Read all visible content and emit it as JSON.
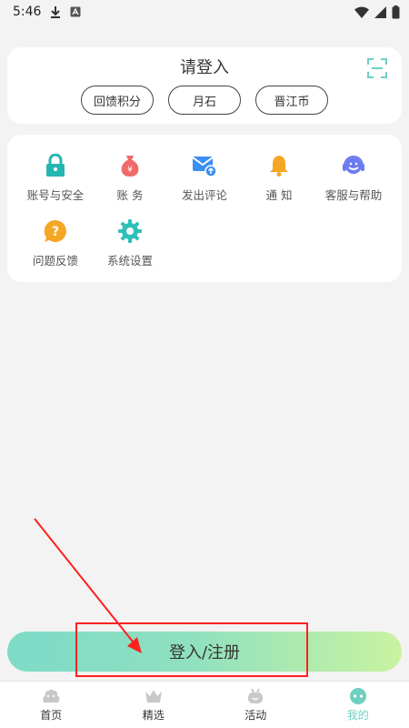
{
  "status_bar": {
    "time": "5:46"
  },
  "login_card": {
    "title": "请登入",
    "pills": [
      {
        "label": "回馈积分"
      },
      {
        "label": "月石"
      },
      {
        "label": "晋江币"
      }
    ]
  },
  "menu": {
    "items": [
      {
        "label": "账号与安全",
        "icon": "lock-icon",
        "color": "#24b6b0"
      },
      {
        "label": "账 务",
        "icon": "money-bag-icon",
        "color": "#f06a6a"
      },
      {
        "label": "发出评论",
        "icon": "mail-icon",
        "color": "#3a8ff0"
      },
      {
        "label": "通 知",
        "icon": "bell-icon",
        "color": "#f5a623"
      },
      {
        "label": "客服与帮助",
        "icon": "headset-icon",
        "color": "#6b7bf0"
      },
      {
        "label": "问题反馈",
        "icon": "question-icon",
        "color": "#f5a623"
      },
      {
        "label": "系统设置",
        "icon": "gear-icon",
        "color": "#2fbfb8"
      }
    ]
  },
  "login_button": {
    "label": "登入/注册"
  },
  "bottom_nav": {
    "items": [
      {
        "label": "首页"
      },
      {
        "label": "精选"
      },
      {
        "label": "活动"
      },
      {
        "label": "我的"
      }
    ],
    "active_color": "#6fd0c0",
    "inactive_color": "#c8c8c8"
  },
  "annotation": {
    "box_color": "#ff2020"
  }
}
